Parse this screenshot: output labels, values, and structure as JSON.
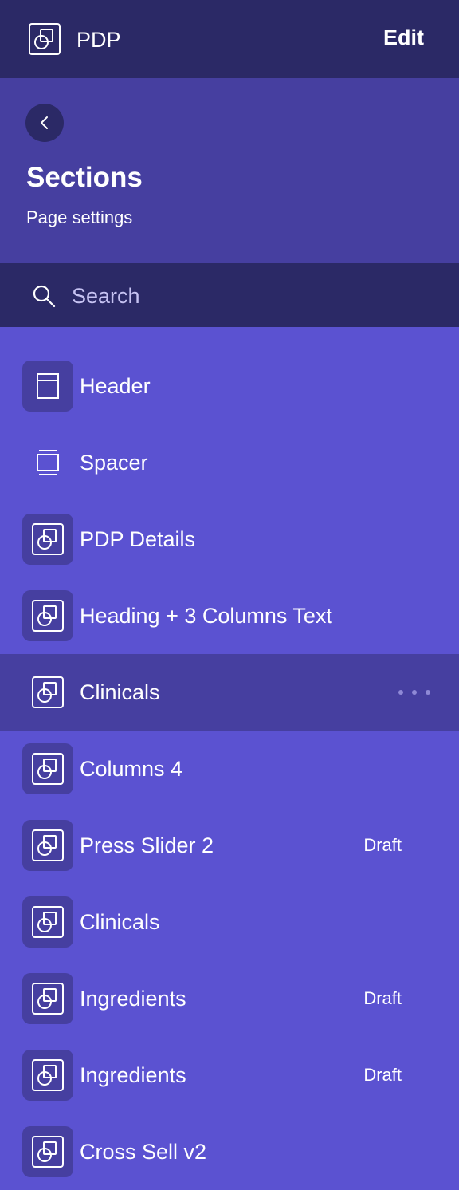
{
  "topbar": {
    "title": "PDP",
    "edit_label": "Edit",
    "icon": "section-block-icon"
  },
  "panel": {
    "back_icon": "chevron-left-icon",
    "heading": "Sections",
    "subtitle": "Page settings"
  },
  "search": {
    "placeholder": "Search",
    "value": "",
    "icon": "search-icon"
  },
  "sections": [
    {
      "label": "Header",
      "icon": "header-icon",
      "badge": ""
    },
    {
      "label": "Spacer",
      "icon": "spacer-icon",
      "badge": ""
    },
    {
      "label": "PDP Details",
      "icon": "section-block-icon",
      "badge": ""
    },
    {
      "label": "Heading + 3 Columns Text",
      "icon": "section-block-icon",
      "badge": ""
    },
    {
      "label": "Clinicals",
      "icon": "section-block-icon",
      "badge": "",
      "selected": true,
      "more_icon": "more-horizontal-icon"
    },
    {
      "label": "Columns 4",
      "icon": "section-block-icon",
      "badge": ""
    },
    {
      "label": "Press Slider 2",
      "icon": "section-block-icon",
      "badge": "Draft"
    },
    {
      "label": "Clinicals",
      "icon": "section-block-icon",
      "badge": ""
    },
    {
      "label": "Ingredients",
      "icon": "section-block-icon",
      "badge": "Draft"
    },
    {
      "label": "Ingredients",
      "icon": "section-block-icon",
      "badge": "Draft"
    },
    {
      "label": "Cross Sell v2",
      "icon": "section-block-icon",
      "badge": ""
    }
  ],
  "colors": {
    "topbar_bg": "#2b2966",
    "panel_bg": "#463fa0",
    "list_bg": "#5b52d1",
    "tile_bg": "#463fa0",
    "text": "#ffffff"
  }
}
